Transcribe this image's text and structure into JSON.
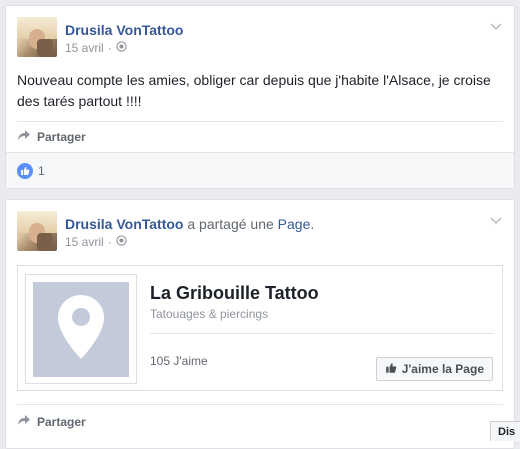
{
  "posts": [
    {
      "author": "Drusila VonTattoo",
      "date": "15 avril",
      "separator": "·",
      "text": "Nouveau compte les amies, obliger car depuis que j'habite l'Alsace, je croise des tarés partout !!!!",
      "share_label": "Partager",
      "like_count": "1"
    },
    {
      "author": "Drusila VonTattoo",
      "shared_text": "a partagé une",
      "shared_link": "Page",
      "shared_end": ".",
      "date": "15 avril",
      "separator": "·",
      "page": {
        "title": "La Gribouille Tattoo",
        "category": "Tatouages & piercings",
        "likes": "105 J'aime",
        "like_button": "J'aime la Page"
      },
      "share_label": "Partager"
    }
  ],
  "corner_tab": "Dis",
  "icons": {
    "globe": "globe-icon",
    "chevron": "chevron-down-icon",
    "share": "share-arrow-icon",
    "like": "thumbs-up-icon",
    "pin": "location-pin-icon"
  },
  "colors": {
    "link": "#365899",
    "like_blue": "#5890ff",
    "placeholder": "#c3cad9"
  }
}
